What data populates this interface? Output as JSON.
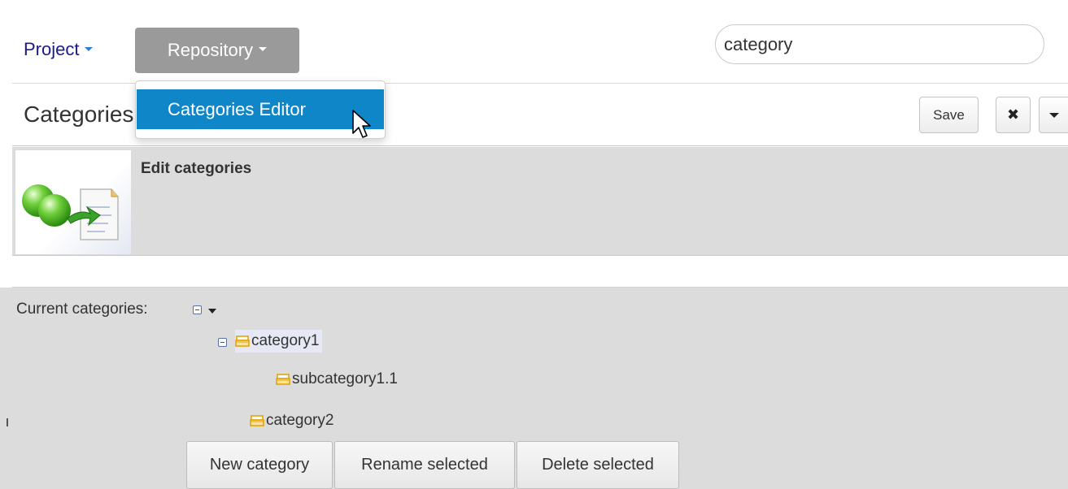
{
  "nav": {
    "project_label": "Project",
    "repository_label": "Repository",
    "search_value": "category"
  },
  "dropdown": {
    "item_label": "Categories Editor"
  },
  "header": {
    "title": "Categories Editor",
    "save_label": "Save",
    "close_label": "✖"
  },
  "description": {
    "title": "Edit categories"
  },
  "tree": {
    "label": "Current categories:",
    "nodes": [
      {
        "label": "category1"
      },
      {
        "label": "subcategory1.1"
      },
      {
        "label": "category2"
      }
    ]
  },
  "actions": {
    "new_label": "New category",
    "rename_label": "Rename selected",
    "delete_label": "Delete selected"
  },
  "colors": {
    "accent": "#0e86c8",
    "nav_active": "#9a9a9a",
    "panel": "#dcdcdc",
    "folder": "#e2a50b"
  }
}
